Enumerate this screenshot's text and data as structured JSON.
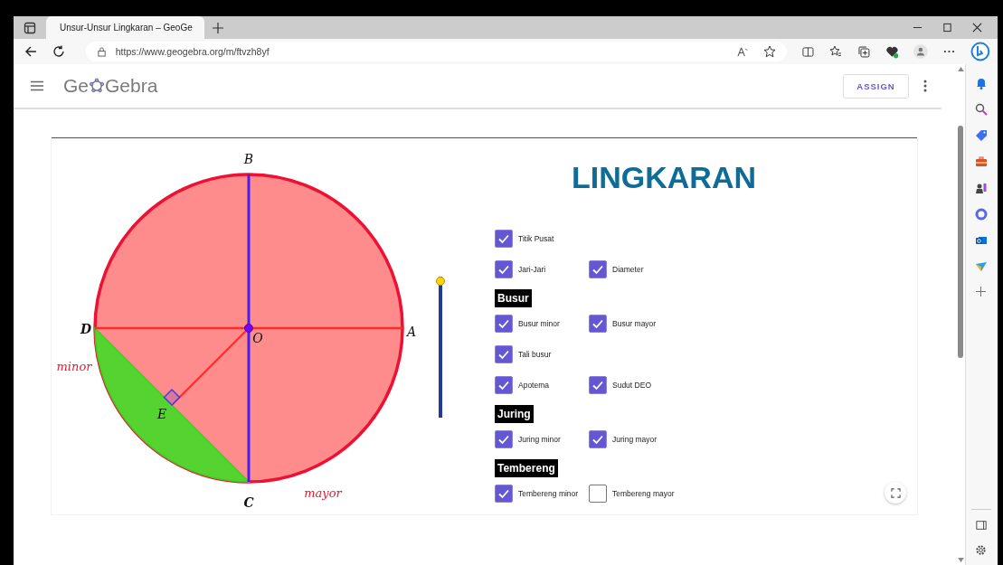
{
  "browser": {
    "tab_title": "Unsur-Unsur Lingkaran – GeoGe",
    "url": "https://www.geogebra.org/m/ftvzh8yf"
  },
  "header": {
    "logo_start": "Ge",
    "logo_end": "Gebra",
    "assign": "ASSIGN"
  },
  "applet": {
    "title": "LINGKARAN",
    "labels": [
      {
        "text": "B",
        "kind": "point"
      },
      {
        "text": "D",
        "kind": "point"
      },
      {
        "text": "O",
        "kind": "point"
      },
      {
        "text": "A",
        "kind": "point"
      },
      {
        "text": "E",
        "kind": "point"
      },
      {
        "text": "C",
        "kind": "point"
      },
      {
        "text": "minor",
        "kind": "arc"
      },
      {
        "text": "mayor",
        "kind": "arc"
      }
    ],
    "slider": {
      "level": 1
    },
    "controls": [
      {
        "kind": "row",
        "items": [
          {
            "label": "Titik Pusat",
            "checked": true
          }
        ]
      },
      {
        "kind": "row",
        "items": [
          {
            "label": "Jari-Jari",
            "checked": true
          },
          {
            "label": "Diameter",
            "checked": true
          }
        ]
      },
      {
        "kind": "heading",
        "label": "Busur"
      },
      {
        "kind": "row",
        "items": [
          {
            "label": "Busur minor",
            "checked": true
          },
          {
            "label": "Busur mayor",
            "checked": true
          }
        ]
      },
      {
        "kind": "row",
        "items": [
          {
            "label": "Tali busur",
            "checked": true
          }
        ]
      },
      {
        "kind": "row",
        "items": [
          {
            "label": "Apotema",
            "checked": true
          },
          {
            "label": "Sudut DEO",
            "checked": true
          }
        ]
      },
      {
        "kind": "heading",
        "label": "Juring"
      },
      {
        "kind": "row",
        "items": [
          {
            "label": "Juring minor",
            "checked": true
          },
          {
            "label": "Juring mayor",
            "checked": true
          }
        ]
      },
      {
        "kind": "heading",
        "label": "Tembereng"
      },
      {
        "kind": "row",
        "items": [
          {
            "label": "Tembereng minor",
            "checked": true
          },
          {
            "label": "Tembereng mayor",
            "checked": false
          }
        ]
      }
    ]
  }
}
